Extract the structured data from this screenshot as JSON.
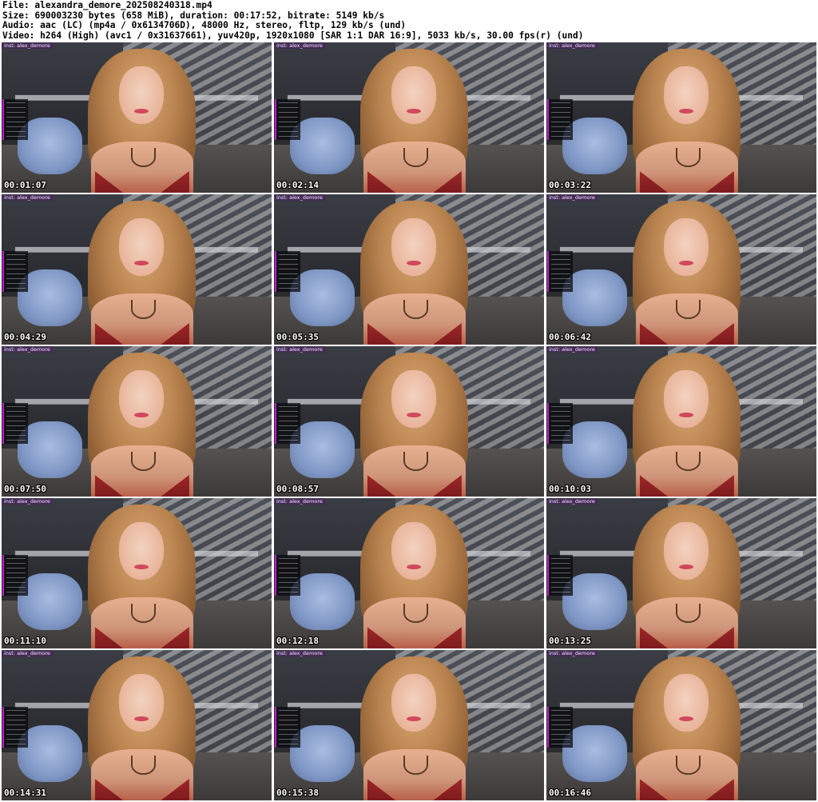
{
  "header": {
    "file": "File: alexandra_demore_202508240318.mp4",
    "size": "Size: 690003230 bytes (658 MiB), duration: 00:17:52, bitrate: 5149 kb/s",
    "audio": "Audio: aac (LC) (mp4a / 0x6134706D), 48000 Hz, stereo, fltp, 129 kb/s (und)",
    "video": "Video: h264 (High) (avc1 / 0x31637661), yuv420p, 1920x1080 [SAR 1:1 DAR 16:9], 5033 kb/s, 30.00 fps(r) (und)"
  },
  "overlay_handle": "inst: alex_demore",
  "thumbnails": [
    {
      "timecode": "00:01:07"
    },
    {
      "timecode": "00:02:14"
    },
    {
      "timecode": "00:03:22"
    },
    {
      "timecode": "00:04:29"
    },
    {
      "timecode": "00:05:35"
    },
    {
      "timecode": "00:06:42"
    },
    {
      "timecode": "00:07:50"
    },
    {
      "timecode": "00:08:57"
    },
    {
      "timecode": "00:10:03"
    },
    {
      "timecode": "00:11:10"
    },
    {
      "timecode": "00:12:18"
    },
    {
      "timecode": "00:13:25"
    },
    {
      "timecode": "00:14:31"
    },
    {
      "timecode": "00:15:38"
    },
    {
      "timecode": "00:16:46"
    }
  ]
}
